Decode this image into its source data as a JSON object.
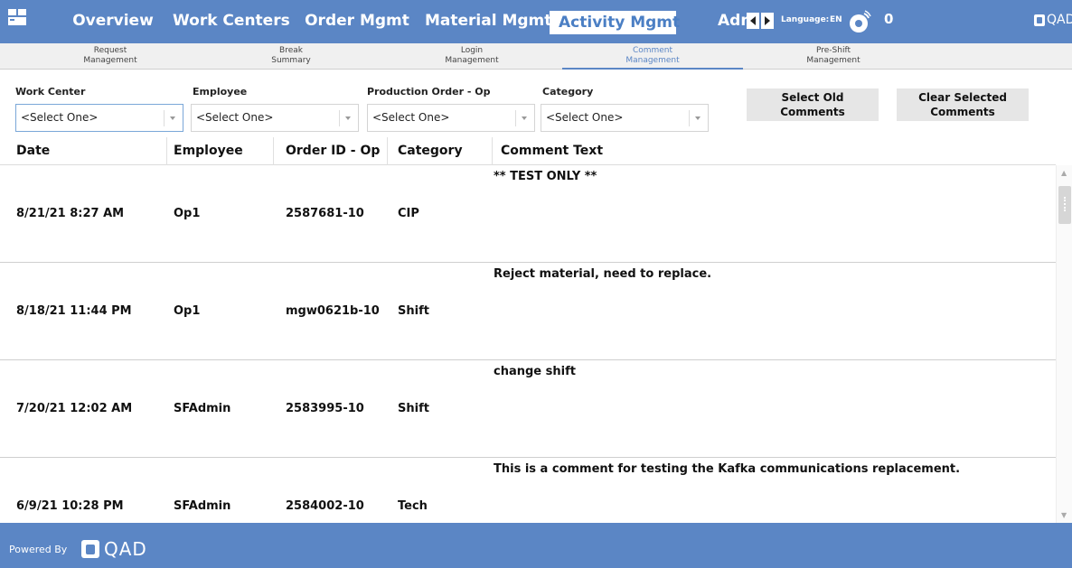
{
  "nav": {
    "tabs": [
      {
        "label": "Overview"
      },
      {
        "label": "Work Centers"
      },
      {
        "label": "Order Mgmt"
      },
      {
        "label": "Material Mgmt"
      },
      {
        "label": "Activity Mgmt",
        "active": true
      },
      {
        "label": "Adm"
      }
    ],
    "language_label": "Language:",
    "language_value": "EN",
    "notification_count": "0",
    "brand": "QAD",
    "accent_color": "#5b86c5"
  },
  "subtabs": [
    {
      "line1": "Request",
      "line2": "Management"
    },
    {
      "line1": "Break",
      "line2": "Summary"
    },
    {
      "line1": "Login",
      "line2": "Management"
    },
    {
      "line1": "Comment",
      "line2": "Management",
      "active": true
    },
    {
      "line1": "Pre-Shift",
      "line2": "Management"
    }
  ],
  "filters": [
    {
      "label": "Work Center",
      "value": "<Select One>"
    },
    {
      "label": "Employee",
      "value": "<Select One>"
    },
    {
      "label": "Production Order - Op",
      "value": "<Select One>"
    },
    {
      "label": "Category",
      "value": "<Select One>"
    }
  ],
  "actions": {
    "select_old": {
      "line1": "Select Old",
      "line2": "Comments"
    },
    "clear_selected": {
      "line1": "Clear Selected",
      "line2": "Comments"
    }
  },
  "table": {
    "columns": [
      "Date",
      "Employee",
      "Order ID - Op",
      "Category",
      "Comment Text"
    ],
    "rows": [
      {
        "date": "8/21/21 8:27 AM",
        "employee": "Op1",
        "order": "2587681-10",
        "category": "CIP",
        "comment": "** TEST ONLY **"
      },
      {
        "date": "8/18/21 11:44 PM",
        "employee": "Op1",
        "order": "mgw0621b-10",
        "category": "Shift",
        "comment": "Reject material, need to replace."
      },
      {
        "date": "7/20/21 12:02 AM",
        "employee": "SFAdmin",
        "order": "2583995-10",
        "category": "Shift",
        "comment": "change shift"
      },
      {
        "date": "6/9/21 10:28 PM",
        "employee": "SFAdmin",
        "order": "2584002-10",
        "category": "Tech",
        "comment": "This is a comment for testing the Kafka communications replacement."
      }
    ]
  },
  "footer": {
    "powered_by": "Powered By",
    "brand": "QAD"
  }
}
